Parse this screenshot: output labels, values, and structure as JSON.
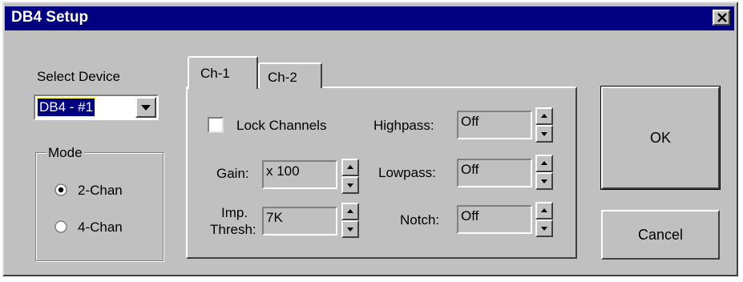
{
  "window": {
    "title": "DB4 Setup"
  },
  "device": {
    "label": "Select Device",
    "selected": "DB4 - #1"
  },
  "mode": {
    "label": "Mode",
    "options": [
      {
        "label": "2-Chan",
        "selected": true
      },
      {
        "label": "4-Chan",
        "selected": false
      }
    ]
  },
  "tabs": [
    {
      "label": "Ch-1",
      "active": true
    },
    {
      "label": "Ch-2",
      "active": false
    }
  ],
  "channel": {
    "lock_label": "Lock Channels",
    "lock_checked": false,
    "gain": {
      "label": "Gain:",
      "value": "x 100"
    },
    "imp_thresh": {
      "label_line1": "Imp.",
      "label_line2": "Thresh:",
      "value": "7K"
    },
    "highpass": {
      "label": "Highpass:",
      "value": "Off"
    },
    "lowpass": {
      "label": "Lowpass:",
      "value": "Off"
    },
    "notch": {
      "label": "Notch:",
      "value": "Off"
    }
  },
  "buttons": {
    "ok": "OK",
    "cancel": "Cancel"
  },
  "icons": {
    "close": "close-icon",
    "dropdown": "chevron-down-icon",
    "spin_up": "arrow-up-icon",
    "spin_down": "arrow-down-icon"
  },
  "colors": {
    "titlebar": "#000080",
    "face": "#c0c0c0",
    "selection": "#000080"
  }
}
